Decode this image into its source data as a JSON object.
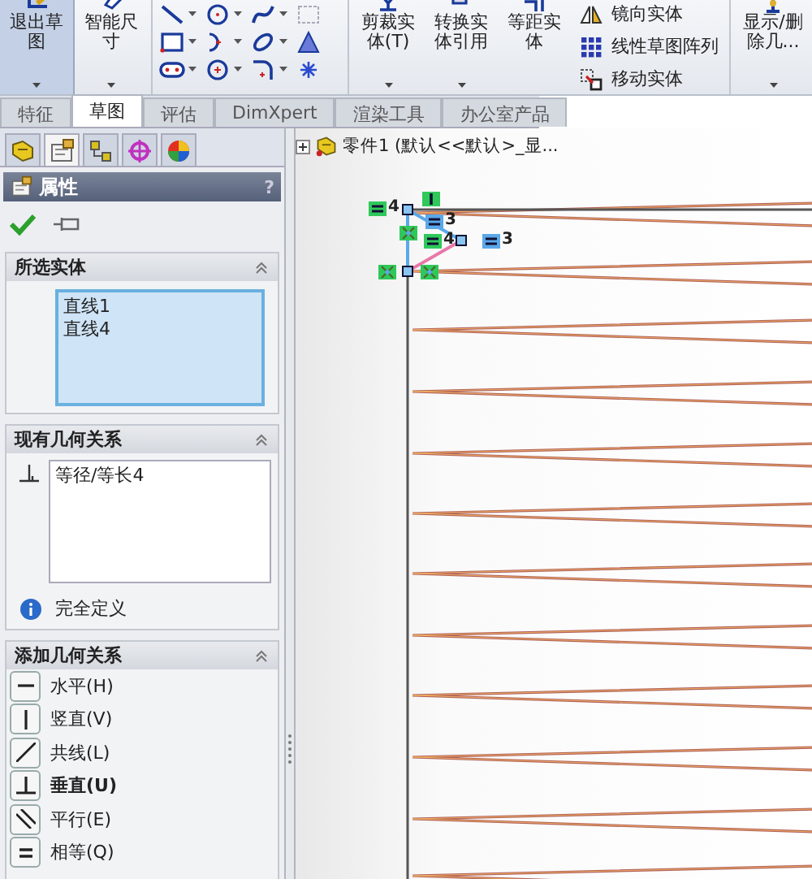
{
  "ribbon": {
    "large_buttons": [
      {
        "label_lines": [
          "退出草",
          "图"
        ],
        "selected": true
      },
      {
        "label_lines": [
          "智能尺",
          "寸"
        ],
        "selected": false
      }
    ],
    "tool_grid": [
      {
        "kind": "line"
      },
      {
        "kind": "circle"
      },
      {
        "kind": "spline"
      },
      {
        "kind": "plane"
      },
      {
        "kind": "rectangle"
      },
      {
        "kind": "arc"
      },
      {
        "kind": "ellipse"
      },
      {
        "kind": "text"
      },
      {
        "kind": "slot"
      },
      {
        "kind": "polygon"
      },
      {
        "kind": "fillet"
      },
      {
        "kind": "point"
      }
    ],
    "mid_buttons": [
      {
        "label_lines": [
          "剪裁实",
          "体(T)"
        ]
      },
      {
        "label_lines": [
          "转换实",
          "体引用"
        ]
      },
      {
        "label_lines": [
          "等距实",
          "体"
        ]
      }
    ],
    "list_buttons": [
      {
        "label": "镜向实体"
      },
      {
        "label": "线性草图阵列"
      },
      {
        "label": "移动实体"
      }
    ],
    "end_button": {
      "label_lines": [
        "显示/删",
        "除几..."
      ]
    }
  },
  "tabs": [
    {
      "label": "特征",
      "selected": false
    },
    {
      "label": "草图",
      "selected": true
    },
    {
      "label": "评估",
      "selected": false
    },
    {
      "label": "DimXpert",
      "selected": false
    },
    {
      "label": "渲染工具",
      "selected": false
    },
    {
      "label": "办公室产品",
      "selected": false
    }
  ],
  "panel": {
    "icon_tabs": [
      {
        "kind": "feature",
        "selected": false
      },
      {
        "kind": "property",
        "selected": true
      },
      {
        "kind": "config",
        "selected": false
      },
      {
        "kind": "dimxpert",
        "selected": false
      },
      {
        "kind": "display",
        "selected": false
      }
    ],
    "title": "属性",
    "help": "?",
    "selected_entities": {
      "title": "所选实体",
      "items": [
        "直线1",
        "直线4"
      ]
    },
    "existing_relations": {
      "title": "现有几何关系",
      "items": [
        "等径/等长4"
      ],
      "status": "完全定义"
    },
    "add_relations": {
      "title": "添加几何关系",
      "items": [
        {
          "kind": "horizontal",
          "label": "水平(H)",
          "highlighted": false
        },
        {
          "kind": "vertical",
          "label": "竖直(V)",
          "highlighted": false
        },
        {
          "kind": "collinear",
          "label": "共线(L)",
          "highlighted": false
        },
        {
          "kind": "perpendicular",
          "label": "垂直(U)",
          "highlighted": true
        },
        {
          "kind": "parallel",
          "label": "平行(E)",
          "highlighted": false
        },
        {
          "kind": "equal",
          "label": "相等(Q)",
          "highlighted": false
        }
      ]
    }
  },
  "tree": {
    "label": "零件1  (默认<<默认>_显..."
  },
  "sketch_markers": [
    {
      "kind": "equal",
      "color": "#2fc85a",
      "label": "4"
    },
    {
      "kind": "vertical",
      "color": "#2fc85a"
    },
    {
      "kind": "equal",
      "color": "#5aa8ea",
      "label": "3"
    },
    {
      "kind": "coincident",
      "color": "#2fc85a"
    },
    {
      "kind": "equal",
      "color": "#2fc85a",
      "label": "4"
    },
    {
      "kind": "equal",
      "color": "#5aa8ea",
      "label": "3"
    },
    {
      "kind": "coincident",
      "color": "#2fc85a"
    },
    {
      "kind": "coincident",
      "color": "#2fc85a"
    }
  ]
}
